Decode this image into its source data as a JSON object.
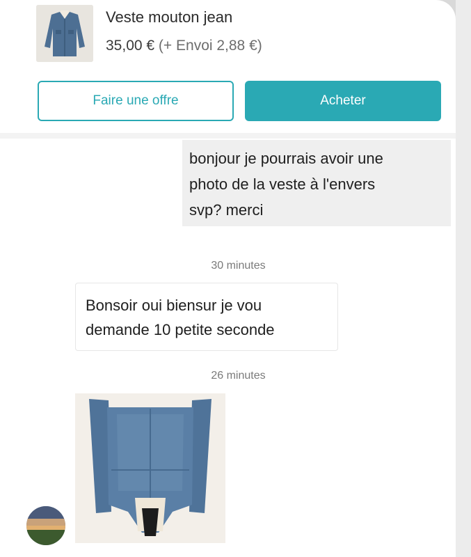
{
  "product": {
    "title": "Veste mouton jean",
    "price": "35,00 €",
    "shipping": " (+ Envoi 2,88 €)",
    "thumbnail_icon": "denim-jacket-image"
  },
  "actions": {
    "offer_label": "Faire une offre",
    "buy_label": "Acheter",
    "accent_color": "#2aa9b4"
  },
  "conversation": {
    "messages": [
      {
        "direction": "outgoing",
        "lines": [
          "bonjour je pourrais avoir une",
          "photo de la veste à l'envers",
          "svp? merci"
        ]
      },
      {
        "direction": "incoming",
        "lines": [
          "Bonsoir oui biensur je vou",
          "demande 10 petite seconde"
        ]
      }
    ],
    "times": [
      "30 minutes",
      "26 minutes"
    ],
    "photo_icon": "jacket-back-photo",
    "avatar_icon": "sunset-avatar"
  }
}
